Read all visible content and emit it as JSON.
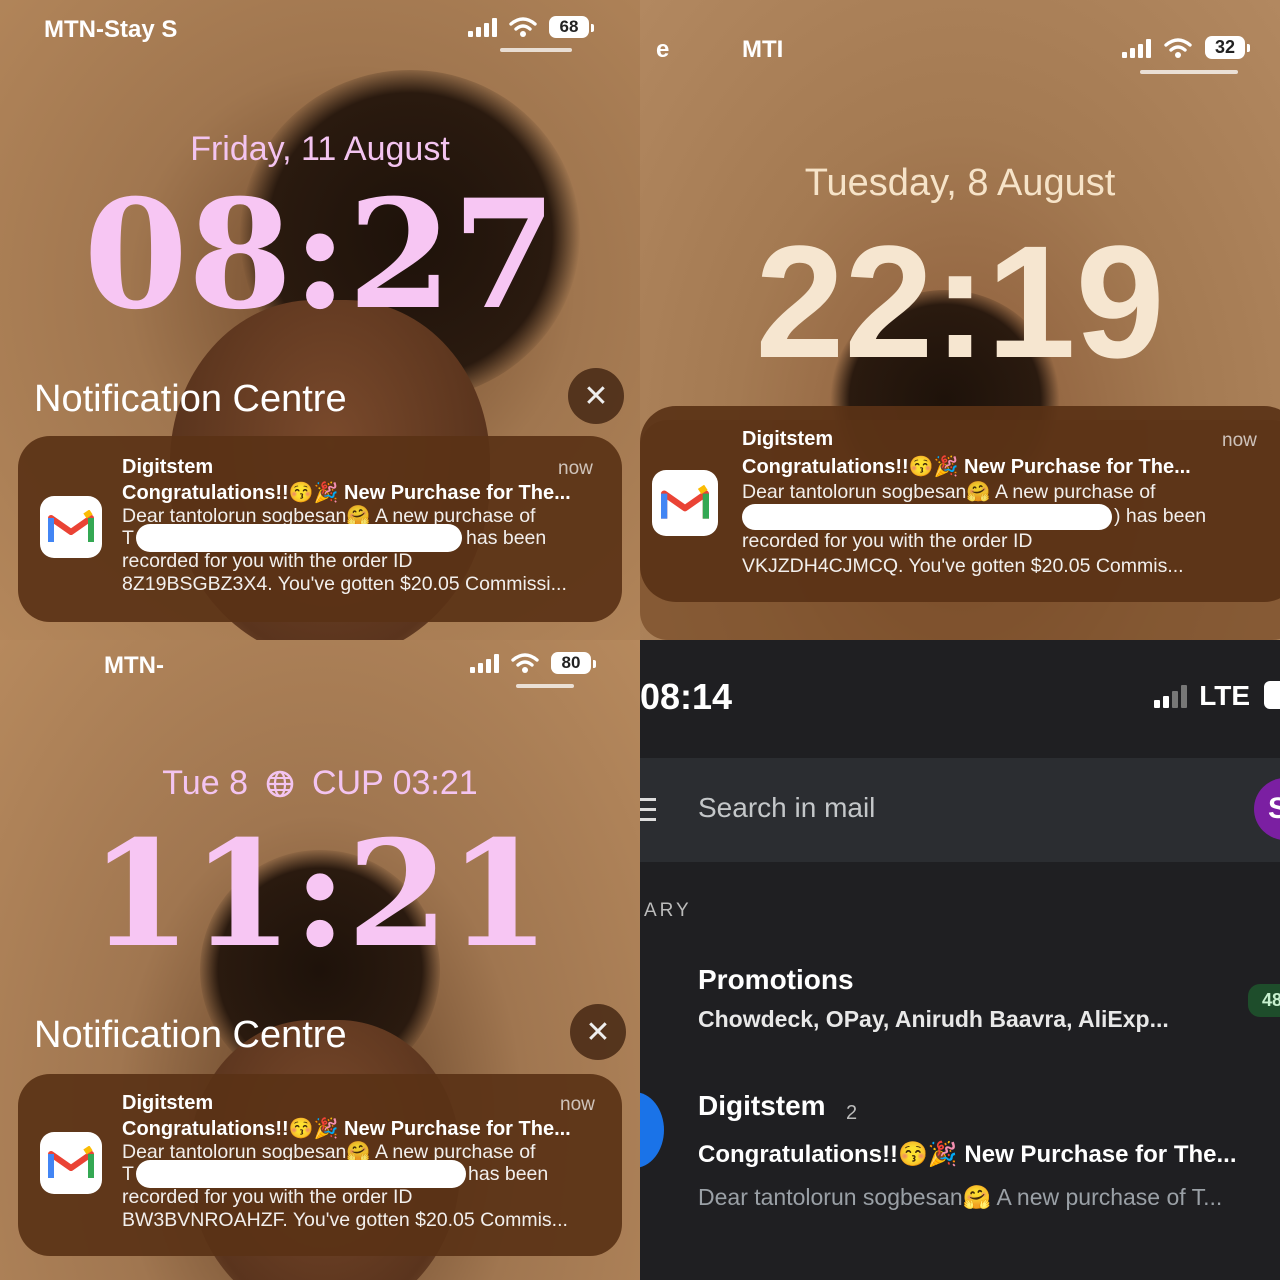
{
  "panels": {
    "friday": {
      "carrier": "MTN-Stay S",
      "battery": "68",
      "date": "Friday, 11 August",
      "time": "08:27",
      "nc_title": "Notification Centre",
      "notification": {
        "sender": "Digitstem",
        "time": "now",
        "subject": "Congratulations!!😚🎉 New Purchase for The...",
        "line1": "Dear tantolorun sogbesan🤗 A new purchase of",
        "line2_prefix": "T",
        "line2_suffix": "has been",
        "line3": "recorded for you with the order ID",
        "line4": "8Z19BSGBZ3X4. You've gotten $20.05 Commissi..."
      }
    },
    "tuesday": {
      "carrier": "MTI",
      "carrier_left": "e",
      "battery": "32",
      "date": "Tuesday, 8 August",
      "time": "22:19",
      "notification": {
        "sender": "Digitstem",
        "time": "now",
        "subject": "Congratulations!!😚🎉 New Purchase for The...",
        "line1": "Dear tantolorun sogbesan🤗 A new purchase of",
        "line2_suffix": ") has been",
        "line3": "recorded for you with the order ID",
        "line4": "VKJZDH4CJMCQ. You've gotten $20.05 Commis..."
      }
    },
    "tue_cup": {
      "carrier": "MTN-",
      "battery": "80",
      "date_left": "Tue 8",
      "date_right": "CUP 03:21",
      "time": "11:21",
      "nc_title": "Notification Centre",
      "notification": {
        "sender": "Digitstem",
        "time": "now",
        "subject": "Congratulations!!😚🎉 New Purchase for The...",
        "line1": "Dear tantolorun sogbesan🤗 A new purchase of",
        "line2_prefix": "T",
        "line2_suffix": "has been",
        "line3": "recorded for you with the order ID",
        "line4": "BW3BVNROAHZF. You've gotten $20.05 Commis..."
      }
    },
    "gmail": {
      "time": "08:14",
      "network": "LTE",
      "search_placeholder": "Search in mail",
      "avatar_letter": "S",
      "section_label": "ARY",
      "promotions": {
        "title": "Promotions",
        "senders": "Chowdeck, OPay, Anirudh Baavra, AliExp...",
        "badge": "48"
      },
      "email": {
        "sender": "Digitstem",
        "count": "2",
        "subject": "Congratulations!!😚🎉 New Purchase for The...",
        "preview": "Dear tantolorun sogbesan🤗 A new purchase of T..."
      }
    }
  },
  "colors": {
    "pink_clock": "#f7c6f3",
    "cream_clock": "#f6e6d0",
    "gmail_red": "#ea4335",
    "gmail_blue": "#4285f4",
    "gmail_green": "#34a853",
    "gmail_yellow": "#fbbc04"
  },
  "icons": [
    "signal-icon",
    "wifi-icon",
    "battery-icon",
    "close-icon",
    "gmail-icon",
    "globe-icon",
    "menu-icon"
  ]
}
